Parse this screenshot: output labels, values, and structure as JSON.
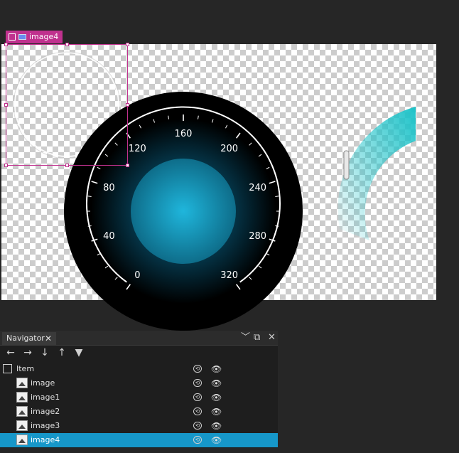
{
  "selection": {
    "tag_label": "image4"
  },
  "gauge": {
    "ticks": [
      "0",
      "40",
      "80",
      "120",
      "160",
      "200",
      "240",
      "280",
      "320"
    ],
    "colors": {
      "accent": "#1fb6dc",
      "cyan_arc": "#1ec3c9",
      "selection": "#c0318e"
    }
  },
  "navigator": {
    "tab_label": "Navigator",
    "rows": [
      {
        "label": "Item",
        "type": "item",
        "selected": false
      },
      {
        "label": "image",
        "type": "image",
        "selected": false
      },
      {
        "label": "image1",
        "type": "image",
        "selected": false
      },
      {
        "label": "image2",
        "type": "image",
        "selected": false
      },
      {
        "label": "image3",
        "type": "image",
        "selected": false
      },
      {
        "label": "image4",
        "type": "image",
        "selected": true
      }
    ],
    "toolbar_icons": [
      "arrow-left-icon",
      "arrow-right-icon",
      "arrow-down-icon",
      "arrow-up-icon",
      "filter-icon"
    ]
  }
}
